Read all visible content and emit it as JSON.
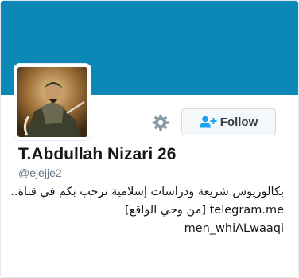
{
  "profile": {
    "display_name": "T.Abdullah Nizari 26",
    "handle": "@ejejje2",
    "bio_lines": [
      "بكالوريوس شريعة ودراسات إسلامية نرحب بكم في قناة..",
      "telegram.me [من وحي الواقع]",
      "men_whiALwaaqi"
    ]
  },
  "actions": {
    "follow_label": "Follow",
    "settings_icon": "gear-icon",
    "follow_icon": "add-user-icon"
  },
  "colors": {
    "banner": "#0b88b5",
    "follow_bg": "#f5f8fa"
  }
}
